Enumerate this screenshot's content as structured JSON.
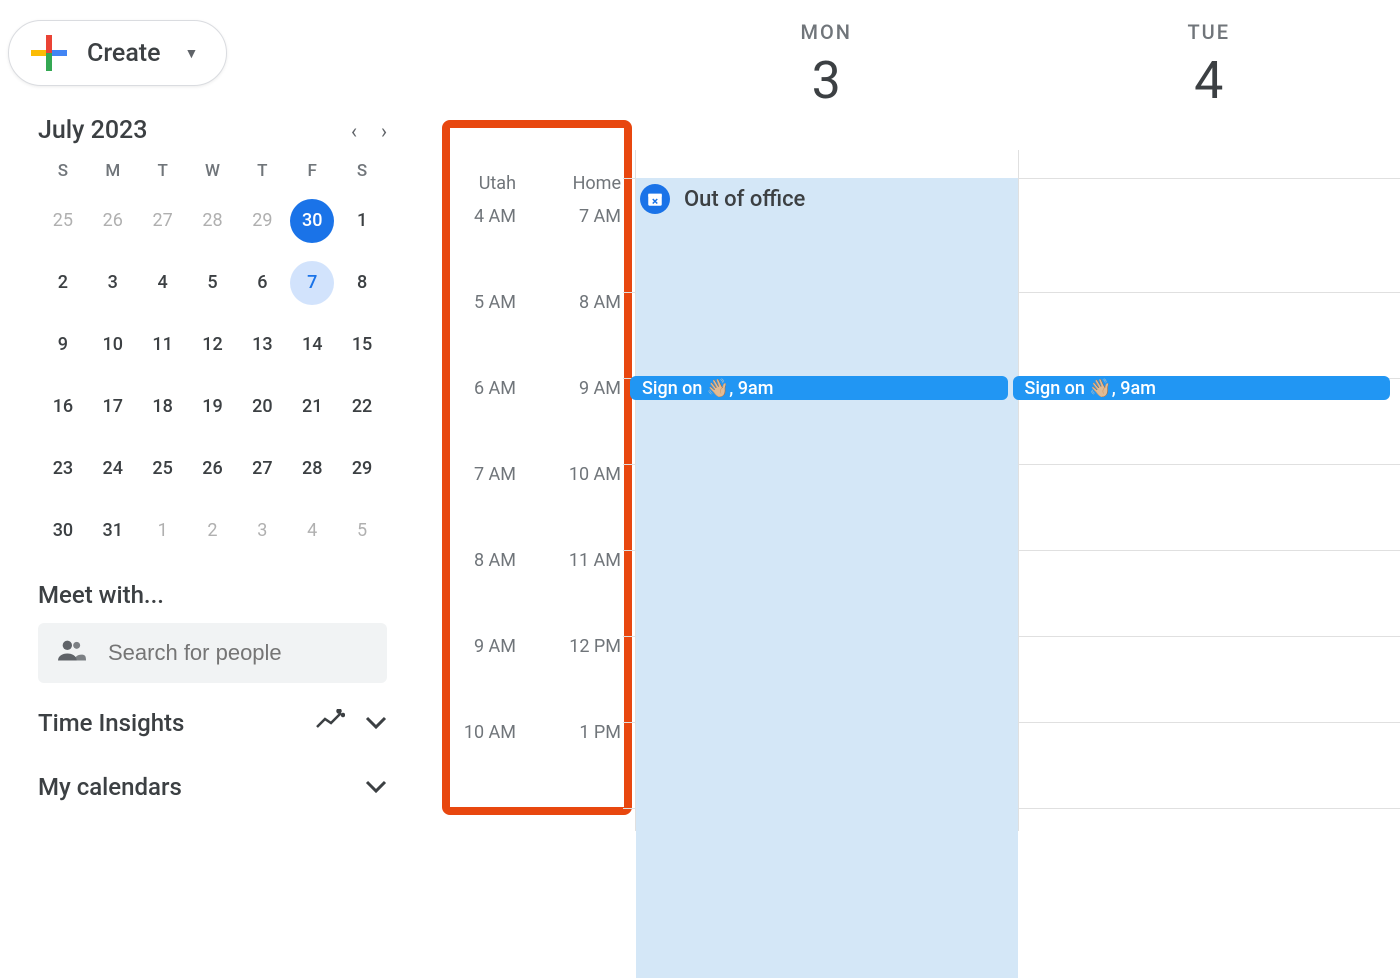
{
  "create_label": "Create",
  "mini_cal": {
    "title": "July 2023",
    "dows": [
      "S",
      "M",
      "T",
      "W",
      "T",
      "F",
      "S"
    ],
    "days": [
      {
        "n": "25",
        "cls": "other"
      },
      {
        "n": "26",
        "cls": "other"
      },
      {
        "n": "27",
        "cls": "other"
      },
      {
        "n": "28",
        "cls": "other"
      },
      {
        "n": "29",
        "cls": "other"
      },
      {
        "n": "30",
        "cls": "today"
      },
      {
        "n": "1",
        "cls": ""
      },
      {
        "n": "2",
        "cls": ""
      },
      {
        "n": "3",
        "cls": ""
      },
      {
        "n": "4",
        "cls": ""
      },
      {
        "n": "5",
        "cls": ""
      },
      {
        "n": "6",
        "cls": ""
      },
      {
        "n": "7",
        "cls": "selected"
      },
      {
        "n": "8",
        "cls": ""
      },
      {
        "n": "9",
        "cls": ""
      },
      {
        "n": "10",
        "cls": ""
      },
      {
        "n": "11",
        "cls": ""
      },
      {
        "n": "12",
        "cls": ""
      },
      {
        "n": "13",
        "cls": ""
      },
      {
        "n": "14",
        "cls": ""
      },
      {
        "n": "15",
        "cls": ""
      },
      {
        "n": "16",
        "cls": ""
      },
      {
        "n": "17",
        "cls": ""
      },
      {
        "n": "18",
        "cls": ""
      },
      {
        "n": "19",
        "cls": ""
      },
      {
        "n": "20",
        "cls": ""
      },
      {
        "n": "21",
        "cls": ""
      },
      {
        "n": "22",
        "cls": ""
      },
      {
        "n": "23",
        "cls": ""
      },
      {
        "n": "24",
        "cls": ""
      },
      {
        "n": "25",
        "cls": ""
      },
      {
        "n": "26",
        "cls": ""
      },
      {
        "n": "27",
        "cls": ""
      },
      {
        "n": "28",
        "cls": ""
      },
      {
        "n": "29",
        "cls": ""
      },
      {
        "n": "30",
        "cls": ""
      },
      {
        "n": "31",
        "cls": ""
      },
      {
        "n": "1",
        "cls": "other"
      },
      {
        "n": "2",
        "cls": "other"
      },
      {
        "n": "3",
        "cls": "other"
      },
      {
        "n": "4",
        "cls": "other"
      },
      {
        "n": "5",
        "cls": "other"
      }
    ]
  },
  "meet_with_title": "Meet with...",
  "search_placeholder": "Search for people",
  "time_insights_title": "Time Insights",
  "my_calendars_title": "My calendars",
  "timezones": [
    {
      "name": "Utah",
      "hours": [
        "4 AM",
        "5 AM",
        "6 AM",
        "7 AM",
        "8 AM",
        "9 AM",
        "10 AM"
      ]
    },
    {
      "name": "Home",
      "hours": [
        "7 AM",
        "8 AM",
        "9 AM",
        "10 AM",
        "11 AM",
        "12 PM",
        "1 PM"
      ]
    }
  ],
  "days": [
    {
      "dow": "MON",
      "num": "3",
      "ooo": true,
      "events": [
        {
          "title": "Sign on 👋🏼, 9am",
          "hour_index": 2
        }
      ]
    },
    {
      "dow": "TUE",
      "num": "4",
      "ooo": false,
      "events": [
        {
          "title": "Sign on 👋🏼, 9am",
          "hour_index": 2
        }
      ]
    }
  ],
  "ooo_label": "Out of office"
}
